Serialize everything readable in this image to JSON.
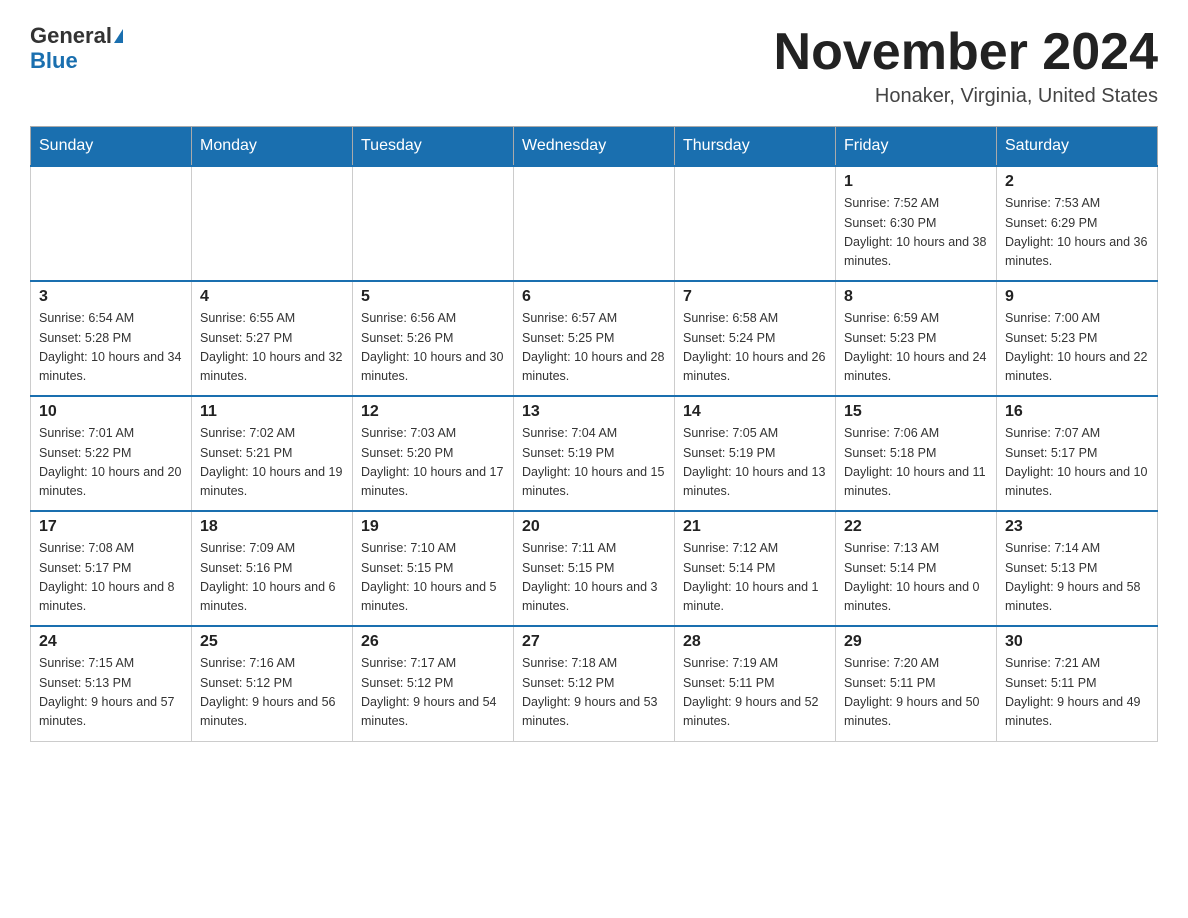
{
  "header": {
    "logo_line1": "General",
    "logo_line2": "Blue",
    "month_title": "November 2024",
    "location": "Honaker, Virginia, United States"
  },
  "weekdays": [
    "Sunday",
    "Monday",
    "Tuesday",
    "Wednesday",
    "Thursday",
    "Friday",
    "Saturday"
  ],
  "weeks": [
    [
      {
        "day": "",
        "sunrise": "",
        "sunset": "",
        "daylight": ""
      },
      {
        "day": "",
        "sunrise": "",
        "sunset": "",
        "daylight": ""
      },
      {
        "day": "",
        "sunrise": "",
        "sunset": "",
        "daylight": ""
      },
      {
        "day": "",
        "sunrise": "",
        "sunset": "",
        "daylight": ""
      },
      {
        "day": "",
        "sunrise": "",
        "sunset": "",
        "daylight": ""
      },
      {
        "day": "1",
        "sunrise": "Sunrise: 7:52 AM",
        "sunset": "Sunset: 6:30 PM",
        "daylight": "Daylight: 10 hours and 38 minutes."
      },
      {
        "day": "2",
        "sunrise": "Sunrise: 7:53 AM",
        "sunset": "Sunset: 6:29 PM",
        "daylight": "Daylight: 10 hours and 36 minutes."
      }
    ],
    [
      {
        "day": "3",
        "sunrise": "Sunrise: 6:54 AM",
        "sunset": "Sunset: 5:28 PM",
        "daylight": "Daylight: 10 hours and 34 minutes."
      },
      {
        "day": "4",
        "sunrise": "Sunrise: 6:55 AM",
        "sunset": "Sunset: 5:27 PM",
        "daylight": "Daylight: 10 hours and 32 minutes."
      },
      {
        "day": "5",
        "sunrise": "Sunrise: 6:56 AM",
        "sunset": "Sunset: 5:26 PM",
        "daylight": "Daylight: 10 hours and 30 minutes."
      },
      {
        "day": "6",
        "sunrise": "Sunrise: 6:57 AM",
        "sunset": "Sunset: 5:25 PM",
        "daylight": "Daylight: 10 hours and 28 minutes."
      },
      {
        "day": "7",
        "sunrise": "Sunrise: 6:58 AM",
        "sunset": "Sunset: 5:24 PM",
        "daylight": "Daylight: 10 hours and 26 minutes."
      },
      {
        "day": "8",
        "sunrise": "Sunrise: 6:59 AM",
        "sunset": "Sunset: 5:23 PM",
        "daylight": "Daylight: 10 hours and 24 minutes."
      },
      {
        "day": "9",
        "sunrise": "Sunrise: 7:00 AM",
        "sunset": "Sunset: 5:23 PM",
        "daylight": "Daylight: 10 hours and 22 minutes."
      }
    ],
    [
      {
        "day": "10",
        "sunrise": "Sunrise: 7:01 AM",
        "sunset": "Sunset: 5:22 PM",
        "daylight": "Daylight: 10 hours and 20 minutes."
      },
      {
        "day": "11",
        "sunrise": "Sunrise: 7:02 AM",
        "sunset": "Sunset: 5:21 PM",
        "daylight": "Daylight: 10 hours and 19 minutes."
      },
      {
        "day": "12",
        "sunrise": "Sunrise: 7:03 AM",
        "sunset": "Sunset: 5:20 PM",
        "daylight": "Daylight: 10 hours and 17 minutes."
      },
      {
        "day": "13",
        "sunrise": "Sunrise: 7:04 AM",
        "sunset": "Sunset: 5:19 PM",
        "daylight": "Daylight: 10 hours and 15 minutes."
      },
      {
        "day": "14",
        "sunrise": "Sunrise: 7:05 AM",
        "sunset": "Sunset: 5:19 PM",
        "daylight": "Daylight: 10 hours and 13 minutes."
      },
      {
        "day": "15",
        "sunrise": "Sunrise: 7:06 AM",
        "sunset": "Sunset: 5:18 PM",
        "daylight": "Daylight: 10 hours and 11 minutes."
      },
      {
        "day": "16",
        "sunrise": "Sunrise: 7:07 AM",
        "sunset": "Sunset: 5:17 PM",
        "daylight": "Daylight: 10 hours and 10 minutes."
      }
    ],
    [
      {
        "day": "17",
        "sunrise": "Sunrise: 7:08 AM",
        "sunset": "Sunset: 5:17 PM",
        "daylight": "Daylight: 10 hours and 8 minutes."
      },
      {
        "day": "18",
        "sunrise": "Sunrise: 7:09 AM",
        "sunset": "Sunset: 5:16 PM",
        "daylight": "Daylight: 10 hours and 6 minutes."
      },
      {
        "day": "19",
        "sunrise": "Sunrise: 7:10 AM",
        "sunset": "Sunset: 5:15 PM",
        "daylight": "Daylight: 10 hours and 5 minutes."
      },
      {
        "day": "20",
        "sunrise": "Sunrise: 7:11 AM",
        "sunset": "Sunset: 5:15 PM",
        "daylight": "Daylight: 10 hours and 3 minutes."
      },
      {
        "day": "21",
        "sunrise": "Sunrise: 7:12 AM",
        "sunset": "Sunset: 5:14 PM",
        "daylight": "Daylight: 10 hours and 1 minute."
      },
      {
        "day": "22",
        "sunrise": "Sunrise: 7:13 AM",
        "sunset": "Sunset: 5:14 PM",
        "daylight": "Daylight: 10 hours and 0 minutes."
      },
      {
        "day": "23",
        "sunrise": "Sunrise: 7:14 AM",
        "sunset": "Sunset: 5:13 PM",
        "daylight": "Daylight: 9 hours and 58 minutes."
      }
    ],
    [
      {
        "day": "24",
        "sunrise": "Sunrise: 7:15 AM",
        "sunset": "Sunset: 5:13 PM",
        "daylight": "Daylight: 9 hours and 57 minutes."
      },
      {
        "day": "25",
        "sunrise": "Sunrise: 7:16 AM",
        "sunset": "Sunset: 5:12 PM",
        "daylight": "Daylight: 9 hours and 56 minutes."
      },
      {
        "day": "26",
        "sunrise": "Sunrise: 7:17 AM",
        "sunset": "Sunset: 5:12 PM",
        "daylight": "Daylight: 9 hours and 54 minutes."
      },
      {
        "day": "27",
        "sunrise": "Sunrise: 7:18 AM",
        "sunset": "Sunset: 5:12 PM",
        "daylight": "Daylight: 9 hours and 53 minutes."
      },
      {
        "day": "28",
        "sunrise": "Sunrise: 7:19 AM",
        "sunset": "Sunset: 5:11 PM",
        "daylight": "Daylight: 9 hours and 52 minutes."
      },
      {
        "day": "29",
        "sunrise": "Sunrise: 7:20 AM",
        "sunset": "Sunset: 5:11 PM",
        "daylight": "Daylight: 9 hours and 50 minutes."
      },
      {
        "day": "30",
        "sunrise": "Sunrise: 7:21 AM",
        "sunset": "Sunset: 5:11 PM",
        "daylight": "Daylight: 9 hours and 49 minutes."
      }
    ]
  ]
}
